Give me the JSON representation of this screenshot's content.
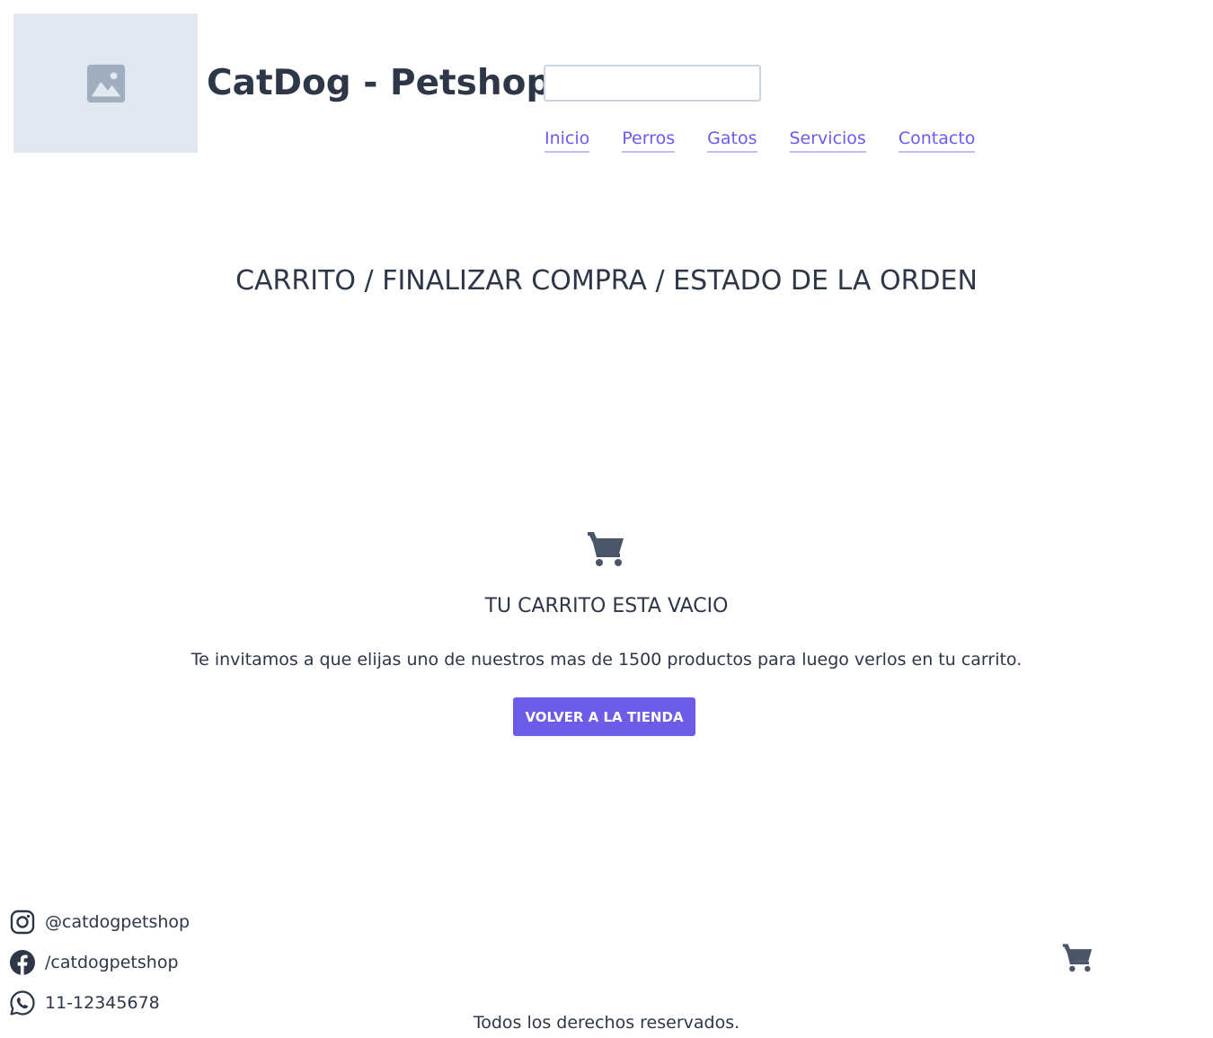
{
  "header": {
    "logo_icon": "image-placeholder-icon",
    "title": "CatDog - Petshop",
    "search": {
      "value": "",
      "placeholder": ""
    },
    "nav": [
      {
        "label": "Inicio"
      },
      {
        "label": "Perros"
      },
      {
        "label": "Gatos"
      },
      {
        "label": "Servicios"
      },
      {
        "label": "Contacto"
      }
    ]
  },
  "main": {
    "heading": "CARRITO / FINALIZAR COMPRA / ESTADO DE LA ORDEN",
    "empty_cart": {
      "icon": "shopping-cart-icon",
      "title": "TU CARRITO ESTA VACIO",
      "message": "Te invitamos a que elijas uno de nuestros mas de 1500 productos para luego verlos en tu carrito.",
      "button_label": "VOLVER A LA TIENDA"
    }
  },
  "footer": {
    "contacts": [
      {
        "icon": "instagram-icon",
        "text": "@catdogpetshop"
      },
      {
        "icon": "facebook-icon",
        "text": "/catdogpetshop"
      },
      {
        "icon": "whatsapp-icon",
        "text": "11-12345678"
      }
    ],
    "cart_icon": "shopping-cart-icon",
    "copyright": "Todos los derechos reservados."
  },
  "colors": {
    "accent": "#6c5ce7",
    "link": "#6b5bf0",
    "text": "#2d3748",
    "placeholder_bg": "#e2e8f0",
    "icon_gray": "#4a5568"
  }
}
